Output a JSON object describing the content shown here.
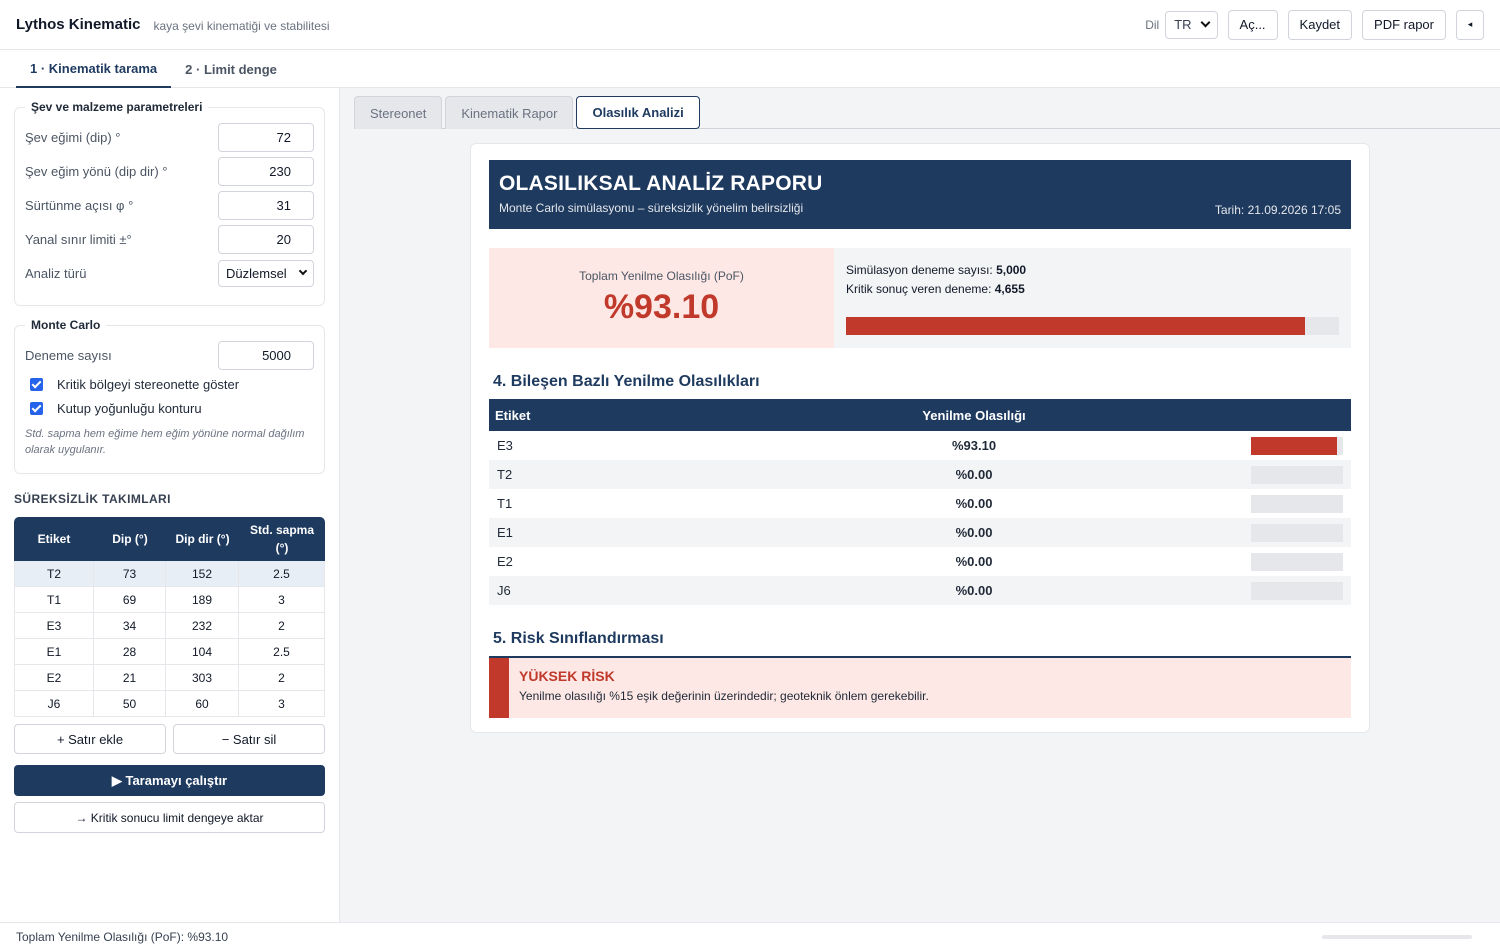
{
  "header": {
    "title": "Lythos Kinematic",
    "subtitle": "kaya şevi kinematiği ve stabilitesi",
    "lang_label": "Dil",
    "lang_value": "TR",
    "open_label": "Aç...",
    "save_label": "Kaydet",
    "pdf_label": "PDF rapor",
    "collapse_glyph": "◂"
  },
  "steps": [
    {
      "label": "1 · Kinematik tarama"
    },
    {
      "label": "2 · Limit denge"
    }
  ],
  "params": {
    "legend": "Şev ve malzeme parametreleri",
    "fields": [
      {
        "label": "Şev eğimi (dip) °",
        "value": "72"
      },
      {
        "label": "Şev eğim yönü (dip dir) °",
        "value": "230"
      },
      {
        "label": "Sürtünme açısı φ °",
        "value": "31"
      },
      {
        "label": "Yanal sınır limiti ±°",
        "value": "20"
      }
    ],
    "analysis_label": "Analiz türü",
    "analysis_value": "Düzlemsel"
  },
  "montecarlo": {
    "legend": "Monte Carlo",
    "trials_label": "Deneme sayısı",
    "trials_value": "5000",
    "check1": "Kritik bölgeyi stereonette göster",
    "check2": "Kutup yoğunluğu konturu",
    "note": "Std. sapma hem eğime hem eğim yönüne normal dağılım olarak uygulanır."
  },
  "disc": {
    "title": "SÜREKSİZLİK TAKIMLARI",
    "headers": [
      "Etiket",
      "Dip (°)",
      "Dip dir (°)",
      "Std. sapma (°)"
    ],
    "rows": [
      [
        "T2",
        "73",
        "152",
        "2.5"
      ],
      [
        "T1",
        "69",
        "189",
        "3"
      ],
      [
        "E3",
        "34",
        "232",
        "2"
      ],
      [
        "E1",
        "28",
        "104",
        "2.5"
      ],
      [
        "E2",
        "21",
        "303",
        "2"
      ],
      [
        "J6",
        "50",
        "60",
        "3"
      ]
    ],
    "add_label": "+ Satır ekle",
    "remove_label": "− Satır sil",
    "run_label": "▶ Taramayı çalıştır",
    "transfer_label": "→ Kritik sonucu limit dengeye aktar"
  },
  "subtabs": [
    {
      "label": "Stereonet"
    },
    {
      "label": "Kinematik Rapor"
    },
    {
      "label": "Olasılık Analizi"
    }
  ],
  "report": {
    "title": "OLASILIKSAL ANALİZ RAPORU",
    "subtitle": "Monte Carlo simülasyonu – süreksizlik yönelim belirsizliği",
    "date": "Tarih: 21.09.2026 17:05",
    "pof_label": "Toplam Yenilme Olasılığı (PoF)",
    "pof_value": "%93.10",
    "pof_fraction": 0.931,
    "sim_label": "Simülasyon deneme sayısı: ",
    "sim_value": "5,000",
    "crit_label": "Kritik sonuç veren deneme: ",
    "crit_value": "4,655",
    "section4_title": "4. Bileşen Bazlı Yenilme Olasılıkları",
    "comp_headers": [
      "Etiket",
      "Yenilme Olasılığı"
    ],
    "components": [
      {
        "label": "E3",
        "value": "%93.10",
        "fraction": 0.931
      },
      {
        "label": "T2",
        "value": "%0.00",
        "fraction": 0
      },
      {
        "label": "T1",
        "value": "%0.00",
        "fraction": 0
      },
      {
        "label": "E1",
        "value": "%0.00",
        "fraction": 0
      },
      {
        "label": "E2",
        "value": "%0.00",
        "fraction": 0
      },
      {
        "label": "J6",
        "value": "%0.00",
        "fraction": 0
      }
    ],
    "section5_title": "5. Risk Sınıflandırması",
    "risk_title": "YÜKSEK RİSK",
    "risk_text": "Yenilme olasılığı %15 eşik değerinin üzerindedir; geoteknik önlem gerekebilir."
  },
  "status": {
    "text": "Toplam Yenilme Olasılığı (PoF): %93.10"
  },
  "colors": {
    "primary": "#1e3a5f",
    "danger": "#c0392b",
    "danger_bg": "#fde8e6"
  }
}
